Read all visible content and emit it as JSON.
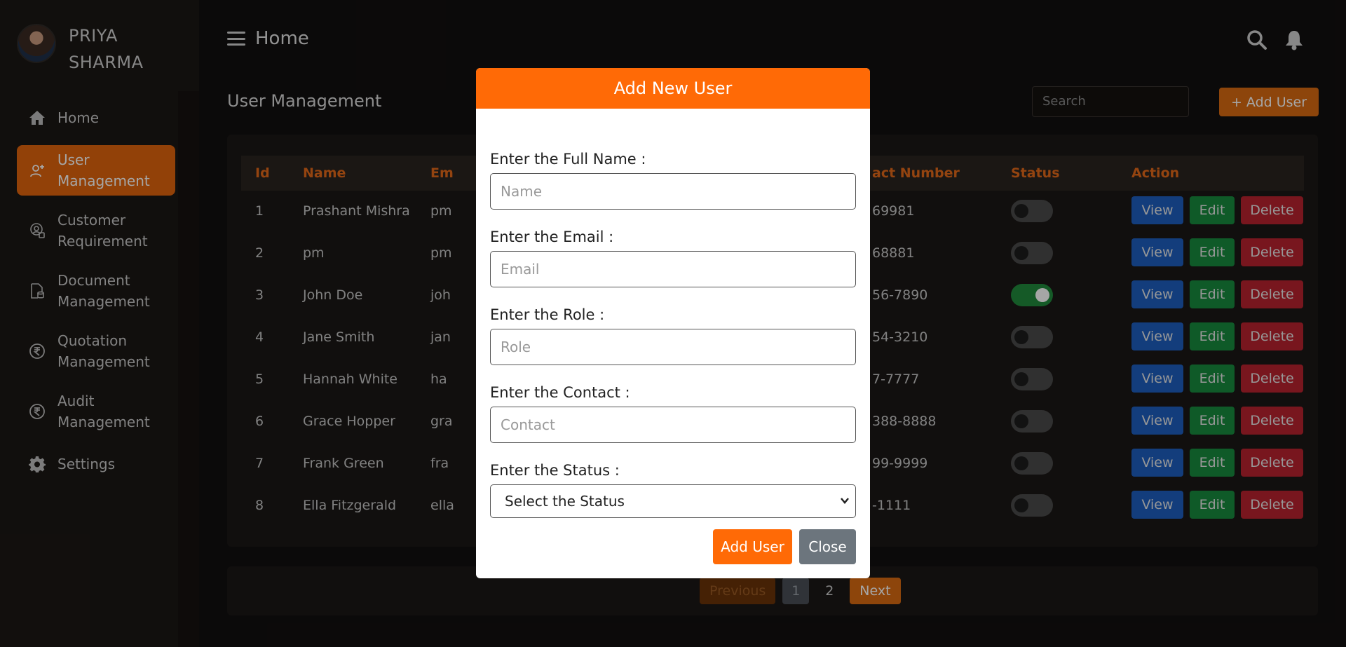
{
  "user": {
    "name_line1": "PRIYA",
    "name_line2": "SHARMA"
  },
  "sidebar": {
    "items": [
      {
        "label": "Home",
        "icon": "home-icon"
      },
      {
        "label_line1": "User",
        "label_line2": "Management",
        "icon": "user-plus-icon",
        "active": true
      },
      {
        "label_line1": "Customer",
        "label_line2": "Requirement",
        "icon": "customer-icon"
      },
      {
        "label_line1": "Document",
        "label_line2": "Management",
        "icon": "document-icon"
      },
      {
        "label_line1": "Quotation",
        "label_line2": "Management",
        "icon": "rupee-icon"
      },
      {
        "label_line1": "Audit",
        "label_line2": "Management",
        "icon": "rupee-icon"
      },
      {
        "label": "Settings",
        "icon": "gear-icon"
      }
    ]
  },
  "header": {
    "title": "Home"
  },
  "main": {
    "page_title": "User Management",
    "search_placeholder": "Search",
    "add_user_label": "+ Add User"
  },
  "table": {
    "columns": [
      "Id",
      "Name",
      "Em",
      "act Number",
      "Status",
      "Action"
    ],
    "rows": [
      {
        "id": "1",
        "name": "Prashant Mishra",
        "email": "pm",
        "contact": "69981",
        "status": false
      },
      {
        "id": "2",
        "name": "pm",
        "email": "pm",
        "contact": "68881",
        "status": false
      },
      {
        "id": "3",
        "name": "John Doe",
        "email": "joh",
        "contact": "56-7890",
        "status": true
      },
      {
        "id": "4",
        "name": "Jane Smith",
        "email": "jan",
        "contact": "54-3210",
        "status": false
      },
      {
        "id": "5",
        "name": "Hannah White",
        "email": "ha",
        "contact": "7-7777",
        "status": false
      },
      {
        "id": "6",
        "name": "Grace Hopper",
        "email": "gra",
        "contact": "388-8888",
        "status": false
      },
      {
        "id": "7",
        "name": "Frank Green",
        "email": "fra",
        "contact": "99-9999",
        "status": false
      },
      {
        "id": "8",
        "name": "Ella Fitzgerald",
        "email": "ella",
        "contact": "-1111",
        "status": false
      }
    ],
    "actions": {
      "view": "View",
      "edit": "Edit",
      "delete": "Delete"
    }
  },
  "pagination": {
    "prev": "Previous",
    "pages": [
      "1",
      "2"
    ],
    "current": "1",
    "next": "Next"
  },
  "modal": {
    "title": "Add New User",
    "fields": [
      {
        "label": "Enter the Full Name :",
        "placeholder": "Name"
      },
      {
        "label": "Enter the Email :",
        "placeholder": "Email"
      },
      {
        "label": "Enter the Role :",
        "placeholder": "Role"
      },
      {
        "label": "Enter the Contact :",
        "placeholder": "Contact"
      }
    ],
    "status_label": "Enter the Status :",
    "status_value": "Select the Status",
    "add_button": "Add User",
    "close_button": "Close"
  },
  "colors": {
    "accent": "#ff6a06",
    "view": "#1e5fbf",
    "edit": "#188a3e",
    "delete": "#b8232e"
  }
}
